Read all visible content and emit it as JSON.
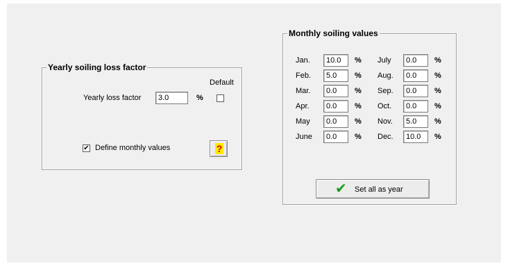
{
  "yearly": {
    "title": "Yearly soiling loss factor",
    "loss_label": "Yearly loss factor",
    "loss_value": "3.0",
    "unit": "%",
    "default_label": "Default",
    "default_checked": false,
    "define_monthly_label": "Define monthly values",
    "define_monthly_checked": true,
    "define_monthly_mark": "✔",
    "help_glyph": "?"
  },
  "monthly": {
    "title": "Monthly soiling values",
    "unit": "%",
    "left": [
      {
        "label": "Jan.",
        "value": "10.0"
      },
      {
        "label": "Feb.",
        "value": "5.0"
      },
      {
        "label": "Mar.",
        "value": "0.0"
      },
      {
        "label": "Apr.",
        "value": "0.0"
      },
      {
        "label": "May",
        "value": "0.0"
      },
      {
        "label": "June",
        "value": "0.0"
      }
    ],
    "right": [
      {
        "label": "July",
        "value": "0.0"
      },
      {
        "label": "Aug.",
        "value": "0.0"
      },
      {
        "label": "Sep.",
        "value": "0.0"
      },
      {
        "label": "Oct.",
        "value": "0.0"
      },
      {
        "label": "Nov.",
        "value": "5.0"
      },
      {
        "label": "Dec.",
        "value": "10.0"
      }
    ],
    "set_all_label": "Set all as year",
    "set_all_icon": "✔"
  }
}
